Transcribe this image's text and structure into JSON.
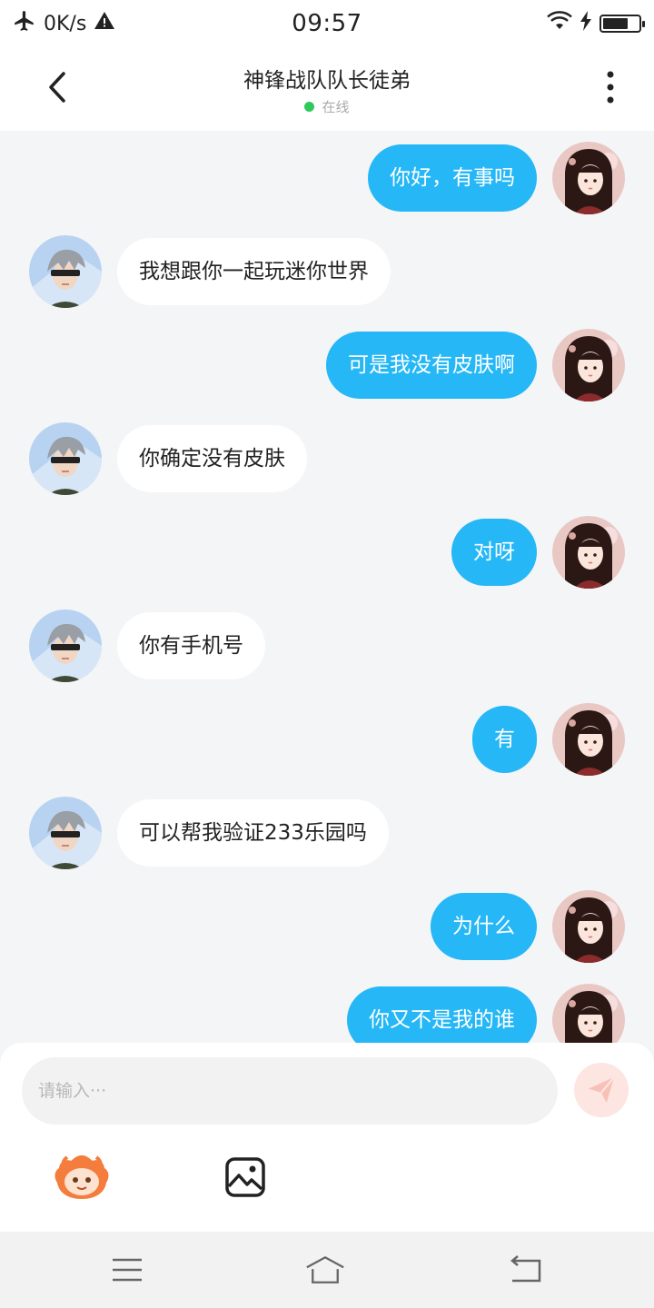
{
  "status_bar": {
    "net_speed": "0K/s",
    "time": "09:57",
    "battery_level": 0.7
  },
  "header": {
    "title": "神锋战队队长徒弟",
    "status": "在线"
  },
  "messages": [
    {
      "side": "right",
      "text": "你好，有事吗"
    },
    {
      "side": "left",
      "text": "我想跟你一起玩迷你世界"
    },
    {
      "side": "right",
      "text": "可是我没有皮肤啊"
    },
    {
      "side": "left",
      "text": "你确定没有皮肤"
    },
    {
      "side": "right",
      "text": "对呀"
    },
    {
      "side": "left",
      "text": "你有手机号"
    },
    {
      "side": "right",
      "text": "有"
    },
    {
      "side": "left",
      "text": "可以帮我验证233乐园吗"
    },
    {
      "side": "right",
      "text": "为什么"
    },
    {
      "side": "right",
      "text": "你又不是我的谁"
    }
  ],
  "input": {
    "placeholder": "请输入···"
  },
  "colors": {
    "accent": "#26b7f6",
    "online": "#2ec95b",
    "send_button": "#fde5e1",
    "background": "#f4f5f7"
  },
  "icons": {
    "status_left": [
      "airplane-icon",
      "warning-icon"
    ],
    "status_right": [
      "wifi-icon",
      "charging-icon",
      "battery-icon"
    ],
    "header": [
      "back-arrow-icon",
      "more-vertical-icon"
    ],
    "input": [
      "send-icon",
      "emoji-sticker-icon",
      "image-icon"
    ],
    "nav": [
      "menu-icon",
      "home-icon",
      "back-icon"
    ]
  }
}
